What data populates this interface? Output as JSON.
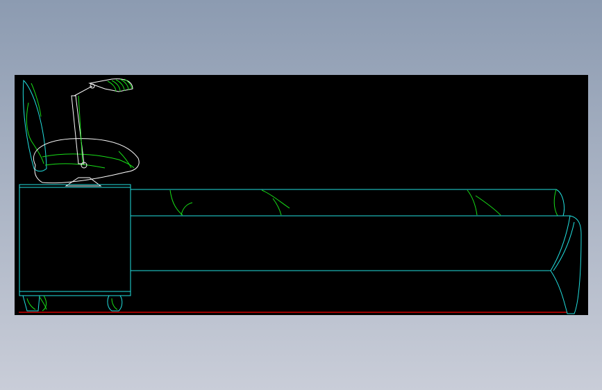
{
  "canvas": {
    "background_gradient_top": "#8c9bb1",
    "background_gradient_bottom": "#c9cdd8",
    "viewport_background": "#000000"
  },
  "drawing": {
    "line_colors": {
      "cyan": "#22e1e1",
      "green": "#18e018",
      "white": "#ffffff",
      "red": "#d00000"
    },
    "parts": [
      "nightstand",
      "nightstand-leg-left",
      "nightstand-leg-right",
      "lamp",
      "pillow",
      "headboard-cushion",
      "mattress",
      "bed-base",
      "footboard",
      "floor-line"
    ]
  }
}
